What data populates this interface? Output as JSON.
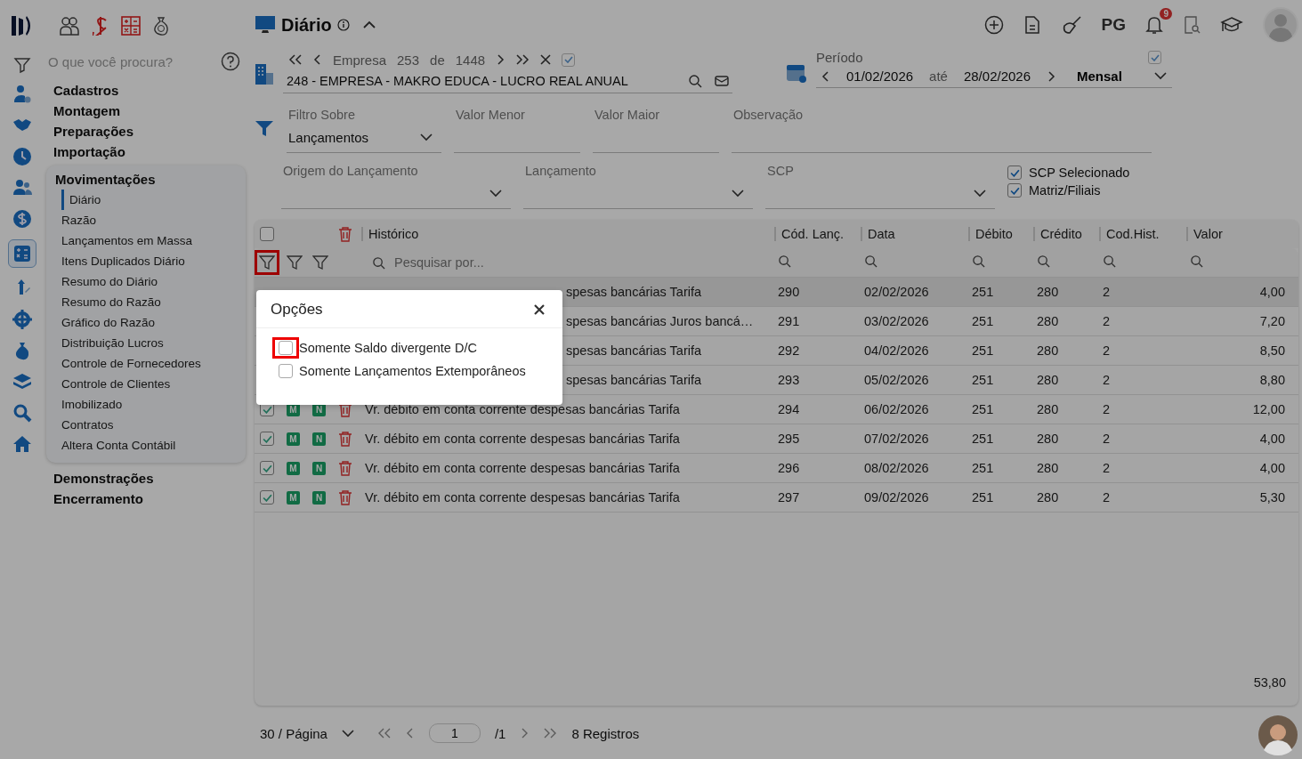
{
  "header": {
    "title": "Diário",
    "shortcut_label": "PG",
    "notification_count": "9"
  },
  "search": {
    "placeholder": "O que você procura?"
  },
  "menu": [
    {
      "label": "Cadastros",
      "expanded": false
    },
    {
      "label": "Montagem",
      "expanded": false
    },
    {
      "label": "Preparações",
      "expanded": false
    },
    {
      "label": "Importação",
      "expanded": false
    },
    {
      "label": "Movimentações",
      "expanded": true,
      "children": [
        {
          "label": "Diário",
          "selected": true
        },
        {
          "label": "Razão",
          "selected": false
        },
        {
          "label": "Lançamentos em Massa",
          "selected": false
        },
        {
          "label": "Itens Duplicados Diário",
          "selected": false
        },
        {
          "label": "Resumo do Diário",
          "selected": false
        },
        {
          "label": "Resumo do Razão",
          "selected": false
        },
        {
          "label": "Gráfico do Razão",
          "selected": false
        },
        {
          "label": "Distribuição Lucros",
          "selected": false
        },
        {
          "label": "Controle de Fornecedores",
          "selected": false
        },
        {
          "label": "Controle de Clientes",
          "selected": false
        },
        {
          "label": "Imobilizado",
          "selected": false
        },
        {
          "label": "Contratos",
          "selected": false
        },
        {
          "label": "Altera Conta Contábil",
          "selected": false
        }
      ]
    },
    {
      "label": "Demonstrações",
      "expanded": false
    },
    {
      "label": "Encerramento",
      "expanded": false
    }
  ],
  "company": {
    "label": "Empresa",
    "index": "253",
    "of": "de",
    "total": "1448",
    "checked": true,
    "name": "248 - EMPRESA - MAKRO EDUCA - LUCRO REAL ANUAL"
  },
  "period": {
    "label": "Período",
    "start": "01/02/2026",
    "to": "até",
    "end": "28/02/2026",
    "mode": "Mensal",
    "checked": true
  },
  "filters": [
    {
      "kind": "select",
      "label": "Filtro Sobre",
      "value": "Lançamentos"
    },
    {
      "kind": "input",
      "label": "Valor Menor"
    },
    {
      "kind": "input",
      "label": "Valor Maior"
    },
    {
      "kind": "input",
      "label": "Observação"
    }
  ],
  "filters_2": [
    {
      "kind": "select",
      "label": "Origem do Lançamento"
    },
    {
      "kind": "select",
      "label": "Lançamento"
    },
    {
      "kind": "select",
      "label": "SCP"
    }
  ],
  "options": [
    {
      "label": "SCP Selecionado",
      "checked": true
    },
    {
      "label": "Matriz/Filiais",
      "checked": true
    }
  ],
  "table": {
    "all_checked": false,
    "filter_highlighted": true,
    "search_placeholder": "Pesquisar por...",
    "columns": [
      "Histórico",
      "Cód. Lanç.",
      "Data",
      "Débito",
      "Crédito",
      "Cod.Hist.",
      "Valor"
    ],
    "rows": [
      {
        "kind": "covered",
        "selected": true,
        "historico": "spesas bancárias Tarifa",
        "cod": "290",
        "data": "02/02/2026",
        "debito": "251",
        "credito": "280",
        "cod_hist": "2",
        "valor": "4,00"
      },
      {
        "kind": "covered",
        "selected": false,
        "historico": "spesas bancárias Juros bancá…",
        "cod": "291",
        "data": "03/02/2026",
        "debito": "251",
        "credito": "280",
        "cod_hist": "2",
        "valor": "7,20"
      },
      {
        "kind": "covered",
        "selected": false,
        "historico": "spesas bancárias Tarifa",
        "cod": "292",
        "data": "04/02/2026",
        "debito": "251",
        "credito": "280",
        "cod_hist": "2",
        "valor": "8,50"
      },
      {
        "kind": "covered",
        "selected": false,
        "historico": "spesas bancárias Tarifa",
        "cod": "293",
        "data": "05/02/2026",
        "debito": "251",
        "credito": "280",
        "cod_hist": "2",
        "valor": "8,80"
      },
      {
        "kind": "full",
        "selected": false,
        "checked": true,
        "badge_1": "M",
        "badge_2": "N",
        "historico": "Vr. débito em conta corrente despesas bancárias Tarifa",
        "cod": "294",
        "data": "06/02/2026",
        "debito": "251",
        "credito": "280",
        "cod_hist": "2",
        "valor": "12,00"
      },
      {
        "kind": "full",
        "selected": false,
        "checked": true,
        "badge_1": "M",
        "badge_2": "N",
        "historico": "Vr. débito em conta corrente despesas bancárias Tarifa",
        "cod": "295",
        "data": "07/02/2026",
        "debito": "251",
        "credito": "280",
        "cod_hist": "2",
        "valor": "4,00"
      },
      {
        "kind": "full",
        "selected": false,
        "checked": true,
        "badge_1": "M",
        "badge_2": "N",
        "historico": "Vr. débito em conta corrente despesas bancárias Tarifa",
        "cod": "296",
        "data": "08/02/2026",
        "debito": "251",
        "credito": "280",
        "cod_hist": "2",
        "valor": "4,00"
      },
      {
        "kind": "full",
        "selected": false,
        "checked": true,
        "badge_1": "M",
        "badge_2": "N",
        "historico": "Vr. débito em conta corrente despesas bancárias Tarifa",
        "cod": "297",
        "data": "09/02/2026",
        "debito": "251",
        "credito": "280",
        "cod_hist": "2",
        "valor": "5,30"
      }
    ],
    "total": "53,80"
  },
  "popup": {
    "title": "Opções",
    "options": [
      {
        "label": "Somente Saldo divergente D/C",
        "checked": false,
        "highlighted": true
      },
      {
        "label": "Somente Lançamentos Extemporâneos",
        "checked": false,
        "highlighted": false
      }
    ]
  },
  "pagination": {
    "page_size": "30 / Página",
    "page": "1",
    "pages": "/1",
    "records": "8 Registros"
  }
}
